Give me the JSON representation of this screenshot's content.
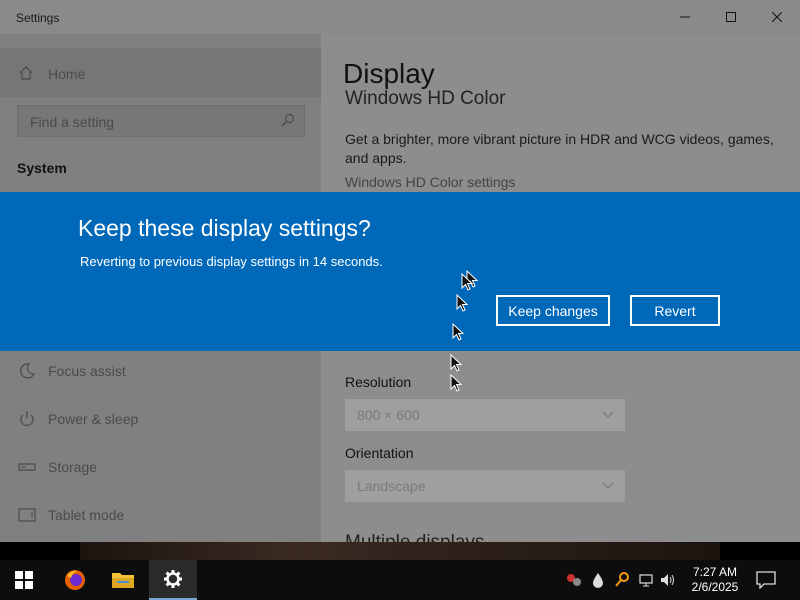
{
  "window": {
    "app_title": "Settings"
  },
  "sidebar": {
    "home_label": "Home",
    "search_placeholder": "Find a setting",
    "section_title": "System",
    "items": [
      {
        "label": "Focus assist",
        "icon": "moon-icon"
      },
      {
        "label": "Power & sleep",
        "icon": "power-icon"
      },
      {
        "label": "Storage",
        "icon": "storage-icon"
      },
      {
        "label": "Tablet mode",
        "icon": "tablet-icon"
      }
    ]
  },
  "main": {
    "page_title": "Display",
    "hd_heading": "Windows HD Color",
    "hd_description": "Get a brighter, more vibrant picture in HDR and WCG videos, games, and apps.",
    "hd_link": "Windows HD Color settings",
    "resolution_label": "Resolution",
    "resolution_value": "800 × 600",
    "orientation_label": "Orientation",
    "orientation_value": "Landscape",
    "multi_heading": "Multiple displays"
  },
  "dialog": {
    "title": "Keep these display settings?",
    "message": "Reverting to previous display settings in 14 seconds.",
    "keep_label": "Keep changes",
    "revert_label": "Revert",
    "accent": "#0068b8"
  },
  "taskbar": {
    "time": "7:27 AM",
    "date": "2/6/2025",
    "apps": [
      "start-icon",
      "firefox-icon",
      "file-explorer-icon",
      "settings-icon"
    ]
  }
}
